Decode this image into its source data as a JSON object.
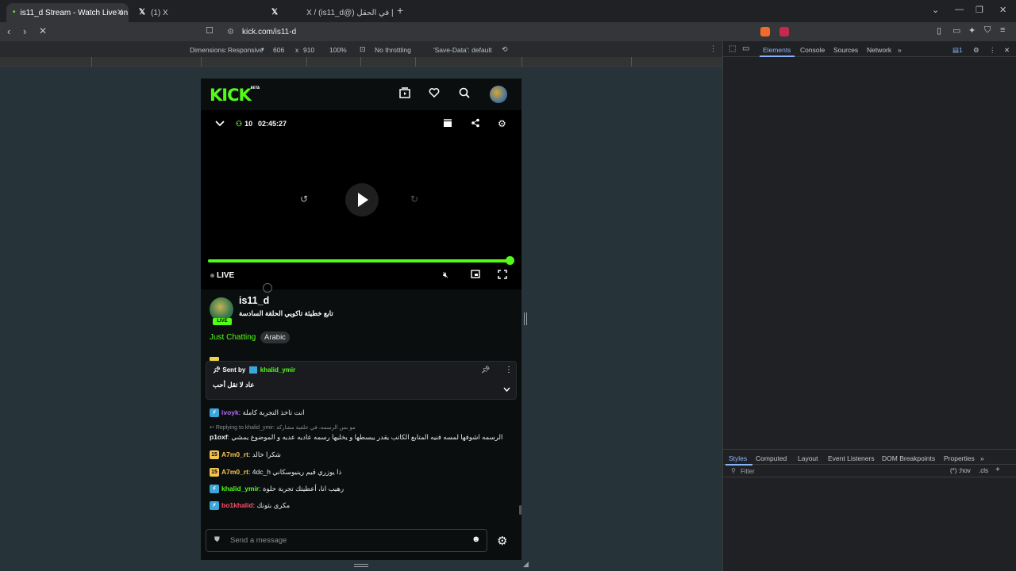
{
  "browser": {
    "tabs": [
      {
        "label": "is11_d Stream - Watch Live on K",
        "active": true
      },
      {
        "label": "(1) X",
        "active": false
      },
      {
        "label": "X / (is11_d@) سعد | في الحقل",
        "active": false
      }
    ],
    "new_tab": "+",
    "url": "kick.com/is11-d"
  },
  "device_toolbar": {
    "dimensions_label": "Dimensions:",
    "mode": "Responsive",
    "width": "606",
    "times": "x",
    "height": "910",
    "zoom": "100%",
    "throttling": "No throttling",
    "save_data": "'Save-Data': default"
  },
  "devtools": {
    "tabs": [
      "Elements",
      "Console",
      "Sources",
      "Network"
    ],
    "active_tab": "Elements",
    "issue_count": "1",
    "lower_tabs": [
      "Styles",
      "Computed",
      "Layout",
      "Event Listeners",
      "DOM Breakpoints",
      "Properties"
    ],
    "filter_placeholder": "Filter",
    "hov": ":hov",
    "cls": ".cls"
  },
  "kick": {
    "logo": "KICK",
    "logo_beta": "BETA",
    "viewer_count": "10",
    "uptime": "02:45:27",
    "live_label": "LIVE",
    "channel_name": "is11_d",
    "stream_title": "تابع خطيئة تاكويي الحلقة السادسة",
    "avatar_live": "LIVE",
    "category": "Just Chatting",
    "language": "Arabic",
    "pinned": {
      "sent_by": "Sent by",
      "user": "khalid_ymir",
      "message": "عاد لا تقل أحب"
    },
    "chat": [
      {
        "user": "ivoyk",
        "user_color": "#b36cf0",
        "badge": "bolt",
        "text": "انت تاخذ التجربة كاملة"
      },
      {
        "reply": "Replying to khalid_ymir: مو بس الرسمه، في خلفية مشاركة"
      },
      {
        "user": "p1oxf",
        "user_color": "#f3f3f3",
        "badge": "",
        "text": "الرسمه اشوفها لمسه فنيه المتابع الكاتب يقدر يبسطها و يخليها رسمه عاديه عديه و الموضوع يمشي"
      },
      {
        "user": "A7m0_rt",
        "user_color": "#f5c451",
        "badge": "15",
        "text": "شكرا خالد"
      },
      {
        "user": "A7m0_rt",
        "user_color": "#f5c451",
        "badge": "15",
        "text": "4dc_h ذا يوزري قيم رينيوسكاني"
      },
      {
        "user": "khalid_ymir",
        "user_color": "#53fc18",
        "badge": "bolt",
        "text": "رهيب انا، أعطيتك تجربة حلوة"
      },
      {
        "user": "bo1khalid",
        "user_color": "#ff4d6a",
        "badge": "bolt",
        "text": "مكري بثونك"
      }
    ],
    "input_placeholder": "Send a message"
  }
}
